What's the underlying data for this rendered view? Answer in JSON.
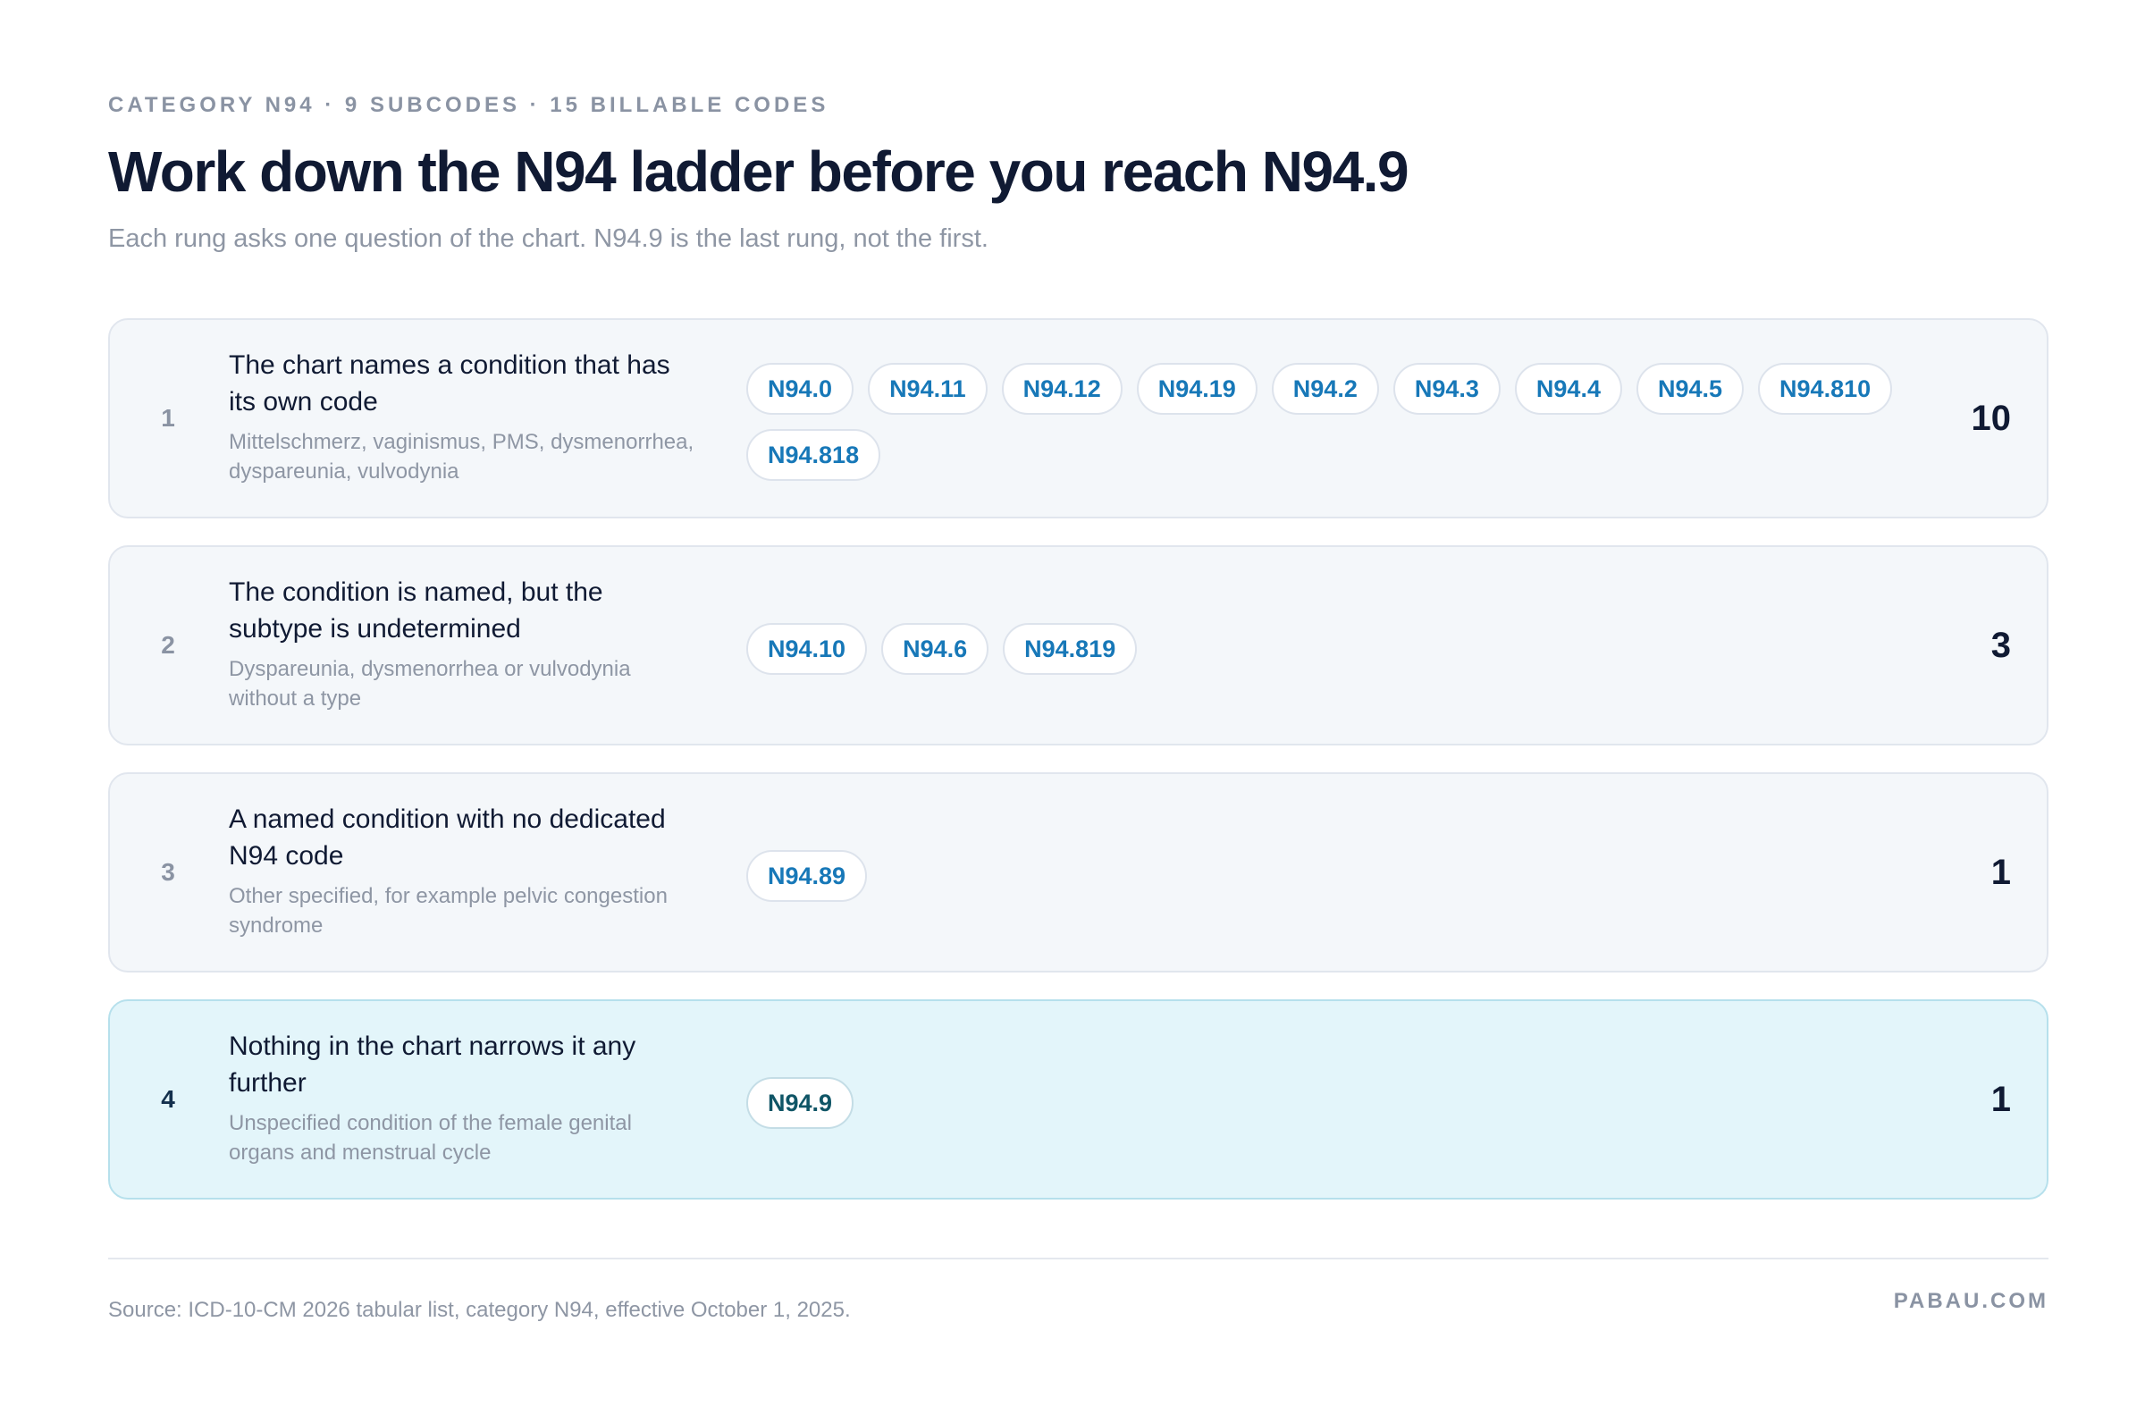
{
  "header": {
    "eyebrow": "CATEGORY N94 · 9 SUBCODES · 15 BILLABLE CODES",
    "title": "Work down the N94 ladder before you reach N94.9",
    "subtitle": "Each rung asks one question of the chart. N94.9 is the last rung, not the first."
  },
  "rungs": [
    {
      "number": "1",
      "question": "The chart names a condition that has its own code",
      "detail": "Mittelschmerz, vaginismus, PMS, dysmenorrhea, dyspareunia, vulvodynia",
      "codes": [
        "N94.0",
        "N94.11",
        "N94.12",
        "N94.19",
        "N94.2",
        "N94.3",
        "N94.4",
        "N94.5",
        "N94.810",
        "N94.818"
      ],
      "count": "10",
      "highlighted": false
    },
    {
      "number": "2",
      "question": "The condition is named, but the subtype is undetermined",
      "detail": "Dyspareunia, dysmenorrhea or vulvodynia without a type",
      "codes": [
        "N94.10",
        "N94.6",
        "N94.819"
      ],
      "count": "3",
      "highlighted": false
    },
    {
      "number": "3",
      "question": "A named condition with no dedicated N94 code",
      "detail": "Other specified, for example pelvic congestion syndrome",
      "codes": [
        "N94.89"
      ],
      "count": "1",
      "highlighted": false
    },
    {
      "number": "4",
      "question": "Nothing in the chart narrows it any further",
      "detail": "Unspecified condition of the female genital organs and menstrual cycle",
      "codes": [
        "N94.9"
      ],
      "count": "1",
      "highlighted": true
    }
  ],
  "footer": {
    "source": "Source: ICD-10-CM 2026 tabular list, category N94, effective October 1, 2025.",
    "brand": "PABAU.COM"
  },
  "colors": {
    "code_text": "#1778b8",
    "final_rung_background": "#e3f5fa",
    "title": "#101a33"
  }
}
